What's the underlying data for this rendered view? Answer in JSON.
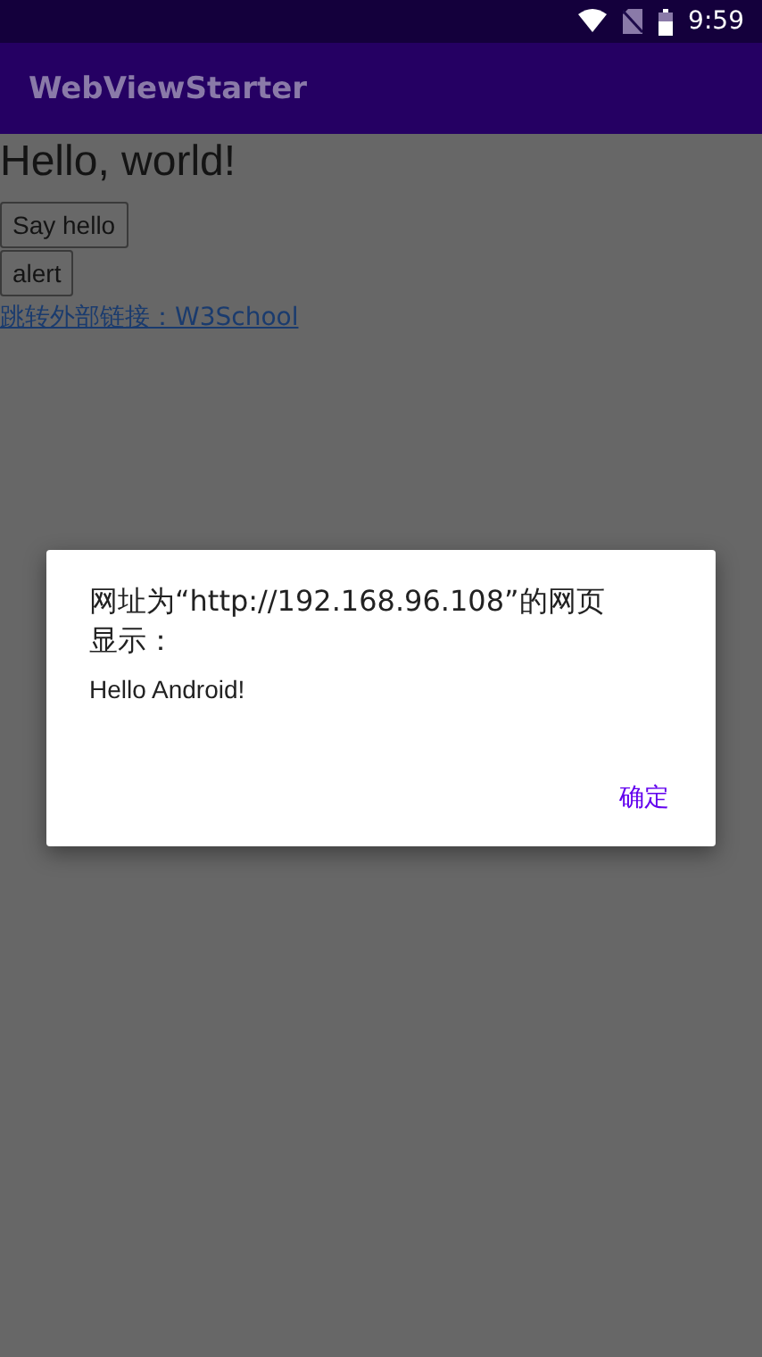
{
  "status_bar": {
    "time": "9:59"
  },
  "app_bar": {
    "title": "WebViewStarter"
  },
  "page": {
    "heading": "Hello, world!",
    "buttons": [
      "Say hello",
      "alert"
    ],
    "link": "跳转外部链接：W3School"
  },
  "dialog": {
    "title": "网址为“http://192.168.96.108”的网页显示：",
    "message": "Hello Android!",
    "buttons": [
      "确定"
    ]
  }
}
